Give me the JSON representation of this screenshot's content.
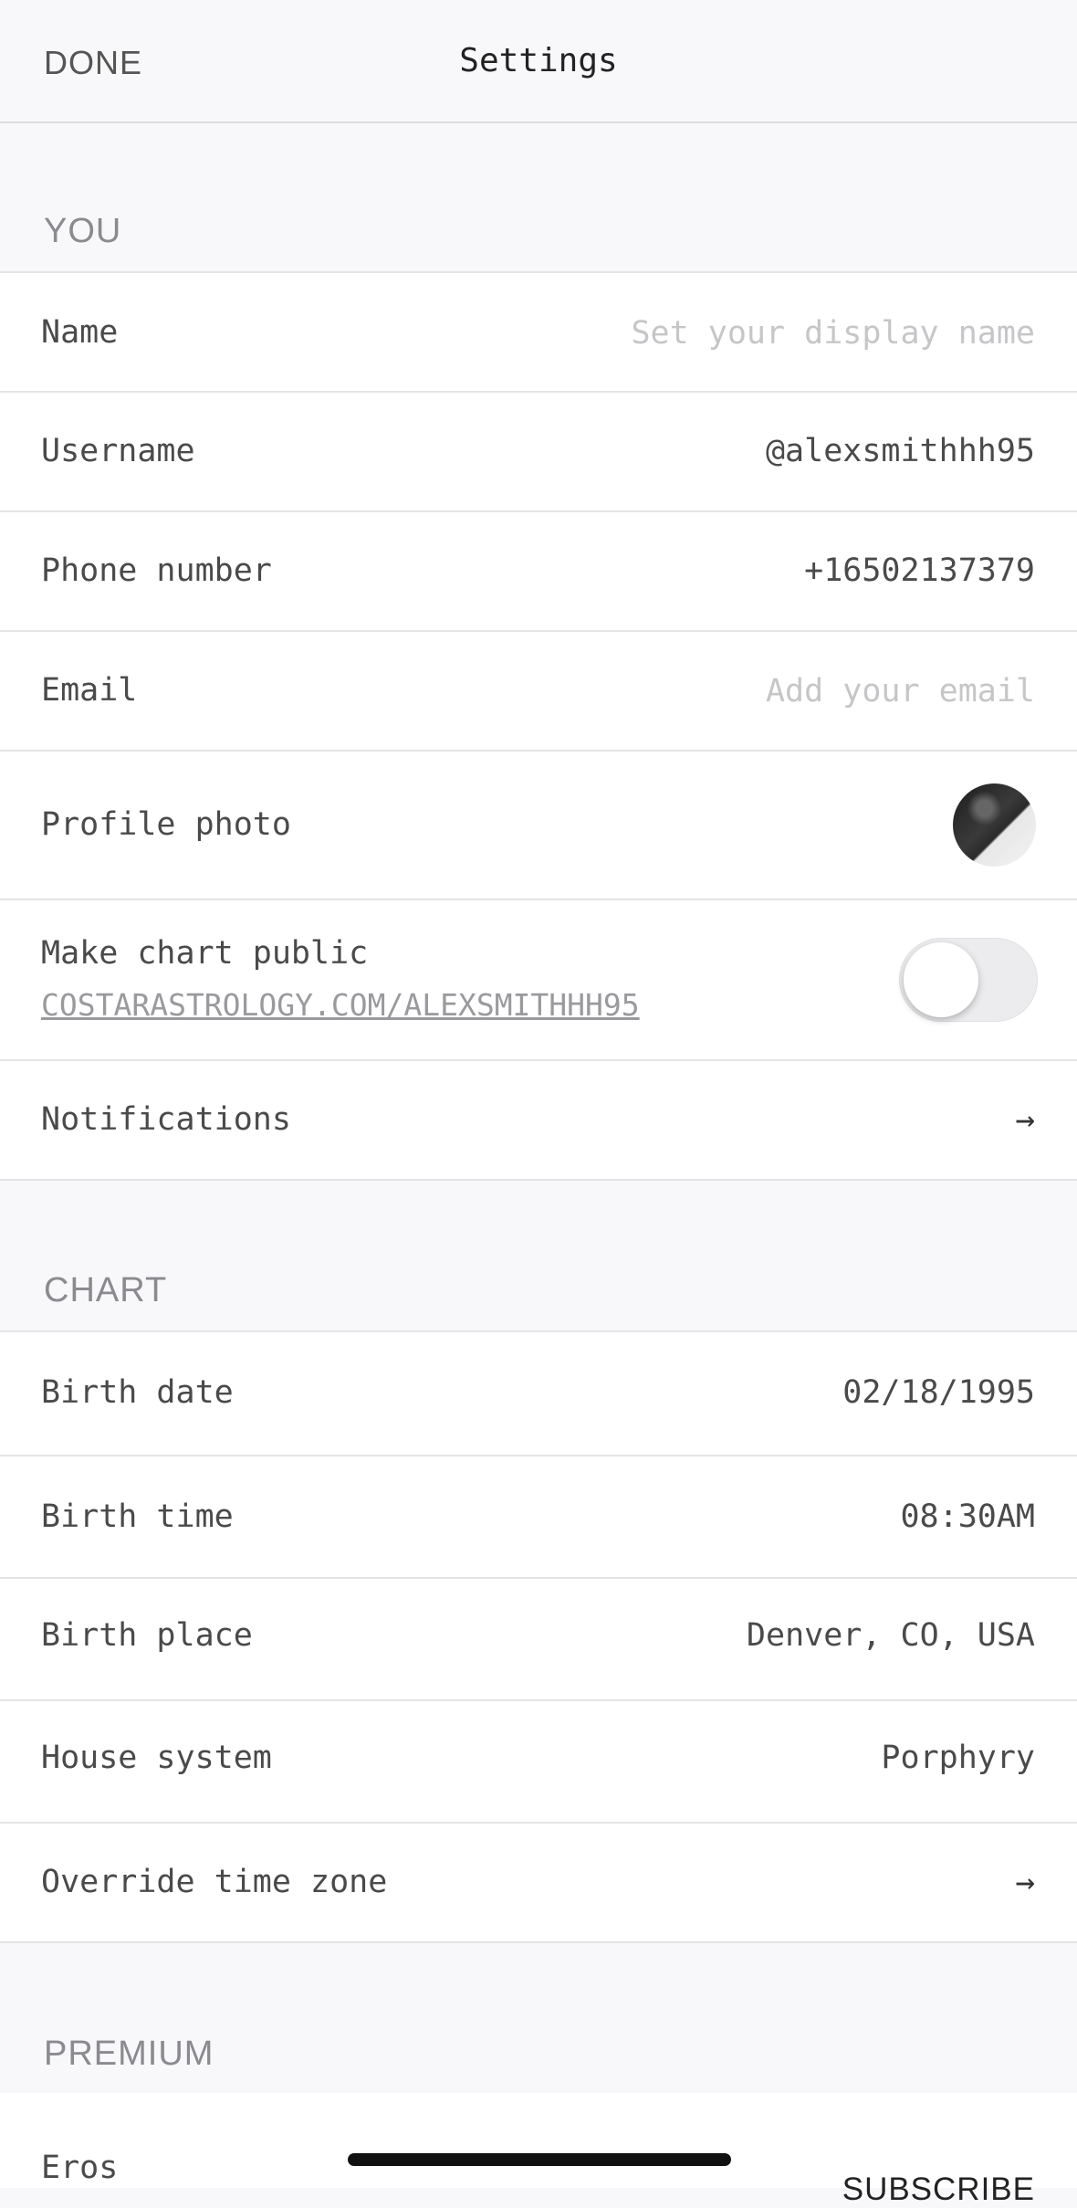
{
  "header": {
    "done_label": "DONE",
    "title": "Settings"
  },
  "sections": {
    "you": "YOU",
    "chart": "CHART",
    "premium": "PREMIUM"
  },
  "you": {
    "name": {
      "label": "Name",
      "placeholder": "Set your display name"
    },
    "username": {
      "label": "Username",
      "value": "@alexsmithhh95"
    },
    "phone": {
      "label": "Phone number",
      "value": "+16502137379"
    },
    "email": {
      "label": "Email",
      "placeholder": "Add your email"
    },
    "photo": {
      "label": "Profile photo",
      "icon": "avatar"
    },
    "public_chart": {
      "label": "Make chart public",
      "link": "COSTARASTROLOGY.COM/ALEXSMITHHH95",
      "enabled": false
    },
    "notifications": {
      "label": "Notifications",
      "arrow": "→"
    }
  },
  "chart": {
    "birth_date": {
      "label": "Birth date",
      "value": "02/18/1995"
    },
    "birth_time": {
      "label": "Birth time",
      "value": "08:30AM"
    },
    "birth_place": {
      "label": "Birth place",
      "value": "Denver, CO, USA"
    },
    "house_system": {
      "label": "House system",
      "value": "Porphyry"
    },
    "override_tz": {
      "label": "Override time zone",
      "arrow": "→"
    }
  },
  "premium": {
    "eros": {
      "label": "Eros",
      "action": "SUBSCRIBE"
    }
  },
  "colors": {
    "background": "#f8f8fa",
    "row_background": "#ffffff",
    "section_label": "#8a8a8f",
    "placeholder": "#c6c6c9"
  }
}
